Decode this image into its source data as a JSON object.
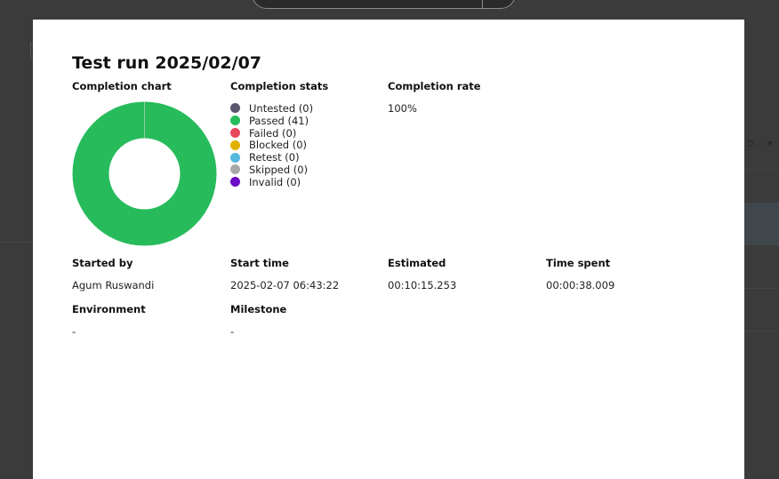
{
  "modal": {
    "title": "Test run 2025/02/07",
    "completion_chart_label": "Completion chart",
    "completion_stats_label": "Completion stats",
    "completion_rate_label": "Completion rate",
    "completion_rate_value": "100%",
    "legend": [
      {
        "label": "Untested (0)",
        "color": "#5b5670",
        "count": 0
      },
      {
        "label": "Passed (41)",
        "color": "#27bb5c",
        "count": 41
      },
      {
        "label": "Failed (0)",
        "color": "#e8485f",
        "count": 0
      },
      {
        "label": "Blocked (0)",
        "color": "#e0b100",
        "count": 0
      },
      {
        "label": "Retest (0)",
        "color": "#56b8de",
        "count": 0
      },
      {
        "label": "Skipped (0)",
        "color": "#a8a8a8",
        "count": 0
      },
      {
        "label": "Invalid (0)",
        "color": "#6a0dc4",
        "count": 0
      }
    ],
    "details": {
      "started_by_label": "Started by",
      "started_by_value": "Agum Ruswandi",
      "start_time_label": "Start time",
      "start_time_value": "2025-02-07 06:43:22",
      "estimated_label": "Estimated",
      "estimated_value": "00:10:15.253",
      "time_spent_label": "Time spent",
      "time_spent_value": "00:00:38.009",
      "environment_label": "Environment",
      "environment_value": "-",
      "milestone_label": "Milestone",
      "milestone_value": "-"
    }
  },
  "background": {
    "truncated_dropdown_text": "b..."
  },
  "chart_data": {
    "type": "pie",
    "categories": [
      "Untested",
      "Passed",
      "Failed",
      "Blocked",
      "Retest",
      "Skipped",
      "Invalid"
    ],
    "values": [
      0,
      41,
      0,
      0,
      0,
      0,
      0
    ],
    "colors": [
      "#5b5670",
      "#27bb5c",
      "#e8485f",
      "#e0b100",
      "#56b8de",
      "#a8a8a8",
      "#6a0dc4"
    ],
    "title": "",
    "legend": "right"
  }
}
